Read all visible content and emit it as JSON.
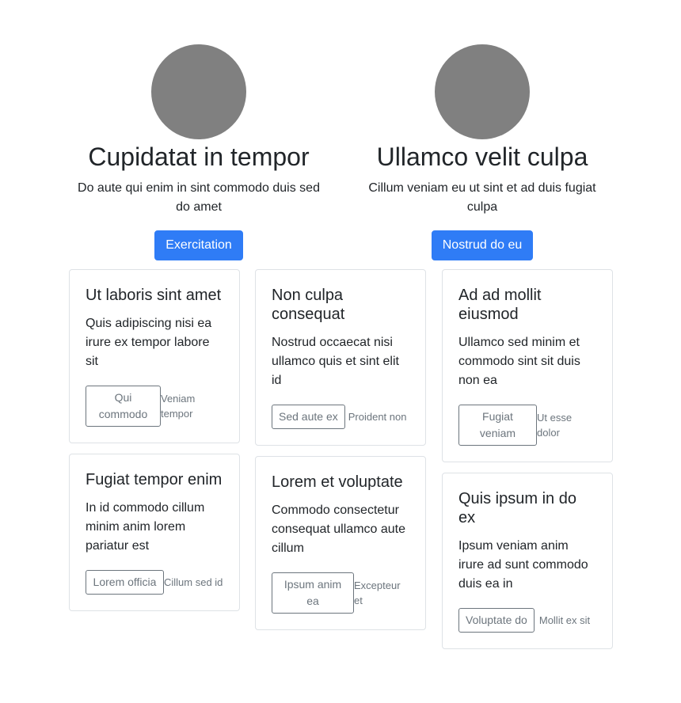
{
  "heroes": [
    {
      "title": "Cupidatat in tempor",
      "text": "Do aute qui enim in sint commodo duis sed do amet",
      "button": "Exercitation"
    },
    {
      "title": "Ullamco velit culpa",
      "text": "Cillum veniam eu ut sint et ad duis fugiat culpa",
      "button": "Nostrud do eu"
    }
  ],
  "cards": {
    "c1": [
      {
        "title": "Ut laboris sint amet",
        "text": "Quis adipiscing nisi ea irure ex tempor labore sit",
        "button": "Qui commodo",
        "note": "Veniam tempor"
      },
      {
        "title": "Fugiat tempor enim",
        "text": "In id commodo cillum minim anim lorem pariatur est",
        "button": "Lorem officia",
        "note": "Cillum sed id"
      }
    ],
    "c2": [
      {
        "title": "Non culpa consequat",
        "text": "Nostrud occaecat nisi ullamco quis et sint elit id",
        "button": "Sed aute ex",
        "note": "Proident non"
      },
      {
        "title": "Lorem et voluptate",
        "text": "Commodo consectetur consequat ullamco aute cillum",
        "button": "Ipsum anim ea",
        "note": "Excepteur et"
      }
    ],
    "c3": [
      {
        "title": "Ad ad mollit eiusmod",
        "text": "Ullamco sed minim et commodo sint sit duis non ea",
        "button": "Fugiat veniam",
        "note": "Ut esse dolor"
      },
      {
        "title": "Quis ipsum in do ex",
        "text": "Ipsum veniam anim irure ad sunt commodo duis ea in",
        "button": "Voluptate do",
        "note": "Mollit ex sit"
      }
    ]
  },
  "colors": {
    "primary": "#2f7cf6",
    "avatar": "#808080",
    "muted": "#6c757d",
    "border": "#dee2e6"
  }
}
